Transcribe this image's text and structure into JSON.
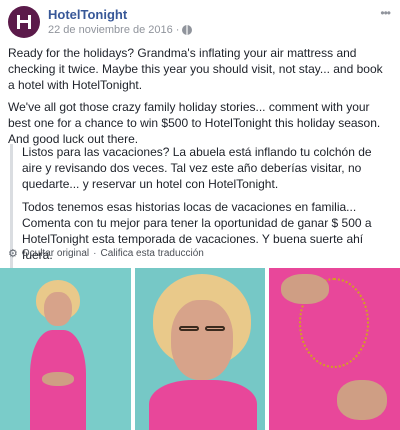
{
  "header": {
    "page_name": "HotelTonight",
    "date": "22 de noviembre de 2016",
    "date_separator": "·",
    "more_icon": "ellipsis-icon",
    "audience_icon": "globe-icon"
  },
  "post": {
    "paragraph_1": "Ready for the holidays? Grandma's inflating your air mattress and checking it twice. Maybe this year you should visit, not stay... and book a hotel with HotelTonight.",
    "paragraph_2": "We've all got those crazy family holiday stories... comment with your best one for a chance to win $500 to HotelTonight this holiday season. And good luck out there."
  },
  "translation": {
    "paragraph_1": "Listos para las vacaciones? La abuela está inflando tu colchón de aire y revisando dos veces. Tal vez este año deberías visitar, no quedarte... y reservar un hotel con HotelTonight.",
    "paragraph_2": "Todos tenemos esas historias locas de vacaciones en familia... Comenta con tu mejor para tener la oportunidad de ganar $ 500 a HotelTonight esta temporada de vacaciones. Y buena suerte ahí fuera."
  },
  "translate_bar": {
    "icon": "gear-icon",
    "hide_original": "Ocultar original",
    "separator": "·",
    "rate_translation": "Califica esta traducción"
  },
  "colors": {
    "link_blue": "#385898",
    "brand": "#5b1a4a",
    "photo_background": "#76c8c6",
    "outfit_pink": "#e8479a"
  }
}
